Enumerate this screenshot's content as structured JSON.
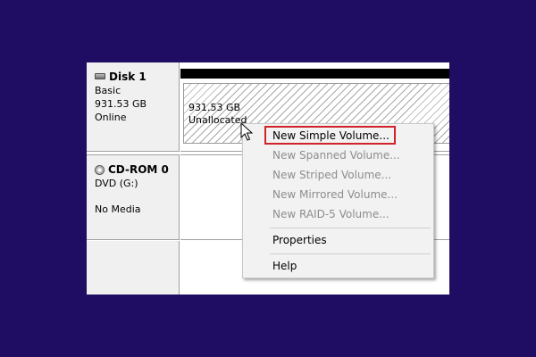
{
  "disk1": {
    "title": "Disk 1",
    "type": "Basic",
    "size": "931.53 GB",
    "status": "Online",
    "icon": "hard-drive-icon"
  },
  "volume": {
    "size": "931.53 GB",
    "status": "Unallocated"
  },
  "cdrom": {
    "title": "CD-ROM 0",
    "drive": "DVD (G:)",
    "media": "No Media",
    "icon": "cd-rom-icon"
  },
  "context_menu": {
    "items": [
      {
        "label": "New Simple Volume...",
        "enabled": true
      },
      {
        "label": "New Spanned Volume...",
        "enabled": false
      },
      {
        "label": "New Striped Volume...",
        "enabled": false
      },
      {
        "label": "New Mirrored Volume...",
        "enabled": false
      },
      {
        "label": "New RAID-5 Volume...",
        "enabled": false
      },
      {
        "label": "Properties",
        "enabled": true
      },
      {
        "label": "Help",
        "enabled": true
      }
    ],
    "highlight_color": "#d0232a"
  },
  "colors": {
    "background": "#1f0c63",
    "panel": "#f0f0f0",
    "disabled_text": "#8d8d8d"
  }
}
